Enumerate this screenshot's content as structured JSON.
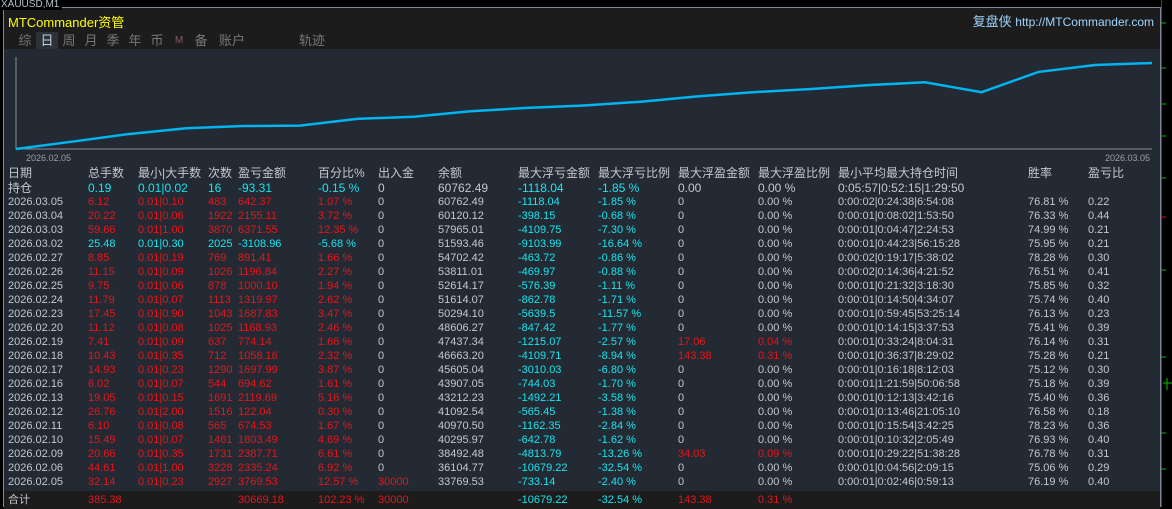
{
  "window_title": "XAUUSD,M1",
  "header": {
    "brand": "MTCommander资管",
    "site_name": "复盘侠",
    "site_url": "http://MTCommander.com"
  },
  "tabs": [
    {
      "label": "综",
      "active": false
    },
    {
      "label": "日",
      "active": true
    },
    {
      "label": "周",
      "active": false
    },
    {
      "label": "月",
      "active": false
    },
    {
      "label": "季",
      "active": false
    },
    {
      "label": "年",
      "active": false
    },
    {
      "label": "币",
      "active": false
    },
    {
      "label": "M",
      "active": false
    },
    {
      "label": "备",
      "active": false
    },
    {
      "label": "账户",
      "active": false
    },
    {
      "label": "轨迹",
      "active": false
    }
  ],
  "chart": {
    "start_label": "2026.02.05",
    "end_label": "2026.03.05",
    "line_color": "#00b4f0"
  },
  "colors": {
    "profit": "#e8141a",
    "loss": "#14e6f0",
    "neutral": "#c3c8d0"
  },
  "table": {
    "columns": [
      "日期",
      "总手数",
      "最小|大手数",
      "次数",
      "盈亏金额",
      "百分比%",
      "出入金",
      "余额",
      "最大浮亏金额",
      "最大浮亏比例",
      "最大浮盈金额",
      "最大浮盈比例",
      "最小平均最大持仓时间",
      "胜率",
      "盈亏比"
    ],
    "holding": [
      "持仓",
      "0.19",
      "0.01|0.02",
      "16",
      "-93.31",
      "-0.15 %",
      "0",
      "60762.49",
      "-1118.04",
      "-1.85 %",
      "0.00",
      "0.00 %",
      "0:05:57|0:52:15|1:29:50",
      "",
      ""
    ],
    "rows": [
      [
        "2026.03.05",
        "6.12",
        "0.01|0.10",
        "483",
        "642.37",
        "1.07 %",
        "0",
        "60762.49",
        "-1118.04",
        "-1.85 %",
        "0",
        "0.00 %",
        "0:00:02|0:24:38|6:54:08",
        "76.81 %",
        "0.22"
      ],
      [
        "2026.03.04",
        "20.22",
        "0.01|0.06",
        "1922",
        "2155.11",
        "3.72 %",
        "0",
        "60120.12",
        "-398.15",
        "-0.68 %",
        "0",
        "0.00 %",
        "0:00:01|0:08:02|1:53:50",
        "76.33 %",
        "0.44"
      ],
      [
        "2026.03.03",
        "59.66",
        "0.01|1.00",
        "3870",
        "6371.55",
        "12.35 %",
        "0",
        "57965.01",
        "-4109.75",
        "-7.30 %",
        "0",
        "0.00 %",
        "0:00:01|0:04:47|2:24:53",
        "74.99 %",
        "0.21"
      ],
      [
        "2026.03.02",
        "25.48",
        "0.01|0.30",
        "2025",
        "-3108.96",
        "-5.68 %",
        "0",
        "51593.46",
        "-9103.99",
        "-16.64 %",
        "0",
        "0.00 %",
        "0:00:01|0:44:23|56:15:28",
        "75.95 %",
        "0.21"
      ],
      [
        "2026.02.27",
        "8.85",
        "0.01|0.19",
        "769",
        "891.41",
        "1.66 %",
        "0",
        "54702.42",
        "-463.72",
        "-0.86 %",
        "0",
        "0.00 %",
        "0:00:02|0:19:17|5:38:02",
        "78.28 %",
        "0.30"
      ],
      [
        "2026.02.26",
        "11.15",
        "0.01|0.09",
        "1026",
        "1196.84",
        "2.27 %",
        "0",
        "53811.01",
        "-469.97",
        "-0.88 %",
        "0",
        "0.00 %",
        "0:00:02|0:14:36|4:21:52",
        "76.51 %",
        "0.41"
      ],
      [
        "2026.02.25",
        "9.75",
        "0.01|0.06",
        "878",
        "1000.10",
        "1.94 %",
        "0",
        "52614.17",
        "-576.39",
        "-1.11 %",
        "0",
        "0.00 %",
        "0:00:01|0:21:32|3:18:30",
        "75.85 %",
        "0.32"
      ],
      [
        "2026.02.24",
        "11.79",
        "0.01|0.07",
        "1113",
        "1319.97",
        "2.62 %",
        "0",
        "51614.07",
        "-862.78",
        "-1.71 %",
        "0",
        "0.00 %",
        "0:00:01|0:14:50|4:34:07",
        "75.74 %",
        "0.40"
      ],
      [
        "2026.02.23",
        "17.45",
        "0.01|0.90",
        "1043",
        "1687.83",
        "3.47 %",
        "0",
        "50294.10",
        "-5639.5",
        "-11.57 %",
        "0",
        "0.00 %",
        "0:00:01|0:59:45|53:25:14",
        "76.13 %",
        "0.23"
      ],
      [
        "2026.02.20",
        "11.12",
        "0.01|0.08",
        "1025",
        "1168.93",
        "2.46 %",
        "0",
        "48606.27",
        "-847.42",
        "-1.77 %",
        "0",
        "0.00 %",
        "0:00:01|0:14:15|3:37:53",
        "75.41 %",
        "0.39"
      ],
      [
        "2026.02.19",
        "7.41",
        "0.01|0.09",
        "637",
        "774.14",
        "1.66 %",
        "0",
        "47437.34",
        "-1215.07",
        "-2.57 %",
        "17.06",
        "0.04 %",
        "0:00:01|0:33:24|8:04:31",
        "76.14 %",
        "0.31"
      ],
      [
        "2026.02.18",
        "10.43",
        "0.01|0.35",
        "712",
        "1058.16",
        "2.32 %",
        "0",
        "46663.20",
        "-4109.71",
        "-8.94 %",
        "143.38",
        "0.31 %",
        "0:00:01|0:36:37|8:29:02",
        "75.28 %",
        "0.21"
      ],
      [
        "2026.02.17",
        "14.93",
        "0.01|0.23",
        "1290",
        "1697.99",
        "3.87 %",
        "0",
        "45605.04",
        "-3010.03",
        "-6.80 %",
        "0",
        "0.00 %",
        "0:00:01|0:16:18|8:12:03",
        "75.12 %",
        "0.30"
      ],
      [
        "2026.02.16",
        "6.02",
        "0.01|0.07",
        "544",
        "694.62",
        "1.61 %",
        "0",
        "43907.05",
        "-744.03",
        "-1.70 %",
        "0",
        "0.00 %",
        "0:00:01|1:21:59|50:06:58",
        "75.18 %",
        "0.39"
      ],
      [
        "2026.02.13",
        "19.05",
        "0.01|0.15",
        "1691",
        "2119.69",
        "5.16 %",
        "0",
        "43212.23",
        "-1492.21",
        "-3.58 %",
        "0",
        "0.00 %",
        "0:00:01|0:12:13|3:42:16",
        "75.40 %",
        "0.36"
      ],
      [
        "2026.02.12",
        "26.76",
        "0.01|2.00",
        "1516",
        "122.04",
        "0.30 %",
        "0",
        "41092.54",
        "-565.45",
        "-1.38 %",
        "0",
        "0.00 %",
        "0:00:01|0:13:46|21:05:10",
        "76.58 %",
        "0.18"
      ],
      [
        "2026.02.11",
        "6.10",
        "0.01|0.08",
        "565",
        "674.53",
        "1.67 %",
        "0",
        "40970.50",
        "-1162.35",
        "-2.84 %",
        "0",
        "0.00 %",
        "0:00:01|0:15:54|3:42:25",
        "78.23 %",
        "0.36"
      ],
      [
        "2026.02.10",
        "15.49",
        "0.01|0.07",
        "1461",
        "1803.49",
        "4.69 %",
        "0",
        "40295.97",
        "-642.78",
        "-1.62 %",
        "0",
        "0.00 %",
        "0:00:01|0:10:32|2:05:49",
        "76.93 %",
        "0.40"
      ],
      [
        "2026.02.09",
        "20.66",
        "0.01|0.35",
        "1731",
        "2387.71",
        "6.61 %",
        "0",
        "38492.48",
        "-4813.79",
        "-13.26 %",
        "34.03",
        "0.09 %",
        "0:00:01|0:29:22|51:38:28",
        "76.78 %",
        "0.31"
      ],
      [
        "2026.02.06",
        "44.61",
        "0.01|1.00",
        "3228",
        "2335.24",
        "6.92 %",
        "0",
        "36104.77",
        "-10679.22",
        "-32.54 %",
        "0",
        "0.00 %",
        "0:00:01|0:04:56|2:09:15",
        "75.06 %",
        "0.29"
      ],
      [
        "2026.02.05",
        "32.14",
        "0.01|0.23",
        "2927",
        "3769.53",
        "12.57 %",
        "30000",
        "33769.53",
        "-733.14",
        "-2.40 %",
        "0",
        "0.00 %",
        "0:00:01|0:02:46|0:59:13",
        "76.19 %",
        "0.40"
      ]
    ],
    "total": [
      "合计",
      "385.38",
      "",
      "",
      "30669.18",
      "102.23 %",
      "30000",
      "",
      "-10679.22",
      "-32.54 %",
      "143.38",
      "0.31 %",
      "",
      "",
      ""
    ]
  }
}
